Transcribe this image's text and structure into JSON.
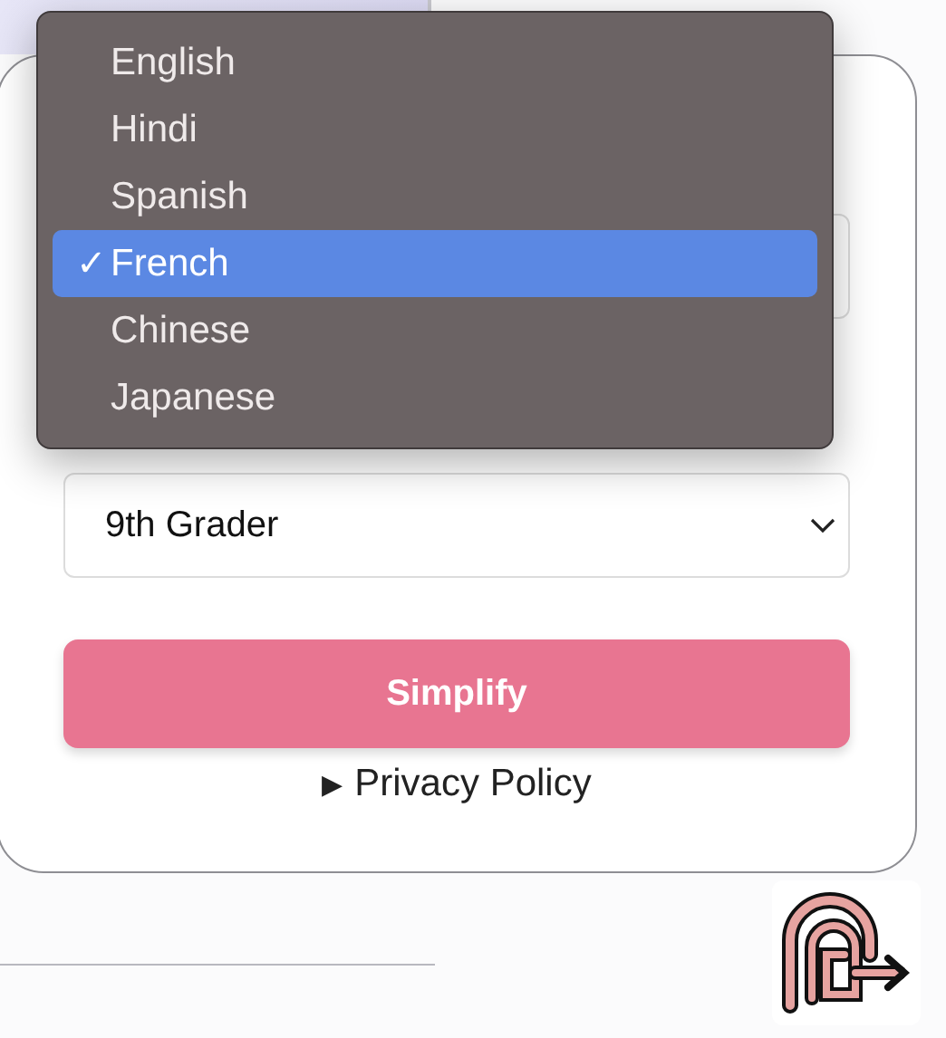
{
  "language_menu": {
    "options": [
      {
        "label": "English",
        "selected": false
      },
      {
        "label": "Hindi",
        "selected": false
      },
      {
        "label": "Spanish",
        "selected": false
      },
      {
        "label": "French",
        "selected": true
      },
      {
        "label": "Chinese",
        "selected": false
      },
      {
        "label": "Japanese",
        "selected": false
      }
    ],
    "check_mark": "✓"
  },
  "level_select": {
    "value": "9th Grader"
  },
  "simplify_button": "Simplify",
  "privacy_policy": {
    "marker": "▶",
    "label": "Privacy Policy",
    "expanded": false
  }
}
